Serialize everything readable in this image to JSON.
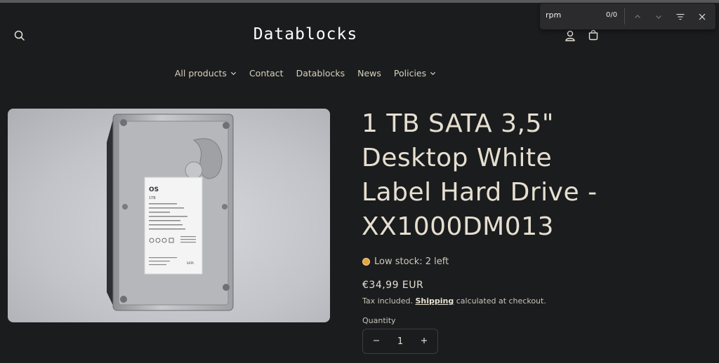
{
  "header": {
    "logo": "Datablocks",
    "icons": [
      "search-icon",
      "account-icon",
      "cart-icon"
    ]
  },
  "nav": {
    "items": [
      {
        "label": "All products",
        "has_dropdown": true
      },
      {
        "label": "Contact",
        "has_dropdown": false
      },
      {
        "label": "Datablocks",
        "has_dropdown": false
      },
      {
        "label": "News",
        "has_dropdown": false
      },
      {
        "label": "Policies",
        "has_dropdown": true
      }
    ]
  },
  "product": {
    "title": "1 TB SATA 3,5\" Desktop White Label Hard Drive - XX1000DM013",
    "stock": "Low stock: 2 left",
    "stock_color": "#e8a23f",
    "price": "€34,99 EUR",
    "tax_prefix": "Tax included.",
    "tax_link": "Shipping",
    "tax_suffix": "calculated at checkout.",
    "quantity_label": "Quantity",
    "quantity_value": "1",
    "label_text": {
      "brand": "OS",
      "capacity": "1TB",
      "interface": "SATA"
    }
  },
  "findbar": {
    "query": "rpm",
    "count": "0/0"
  }
}
